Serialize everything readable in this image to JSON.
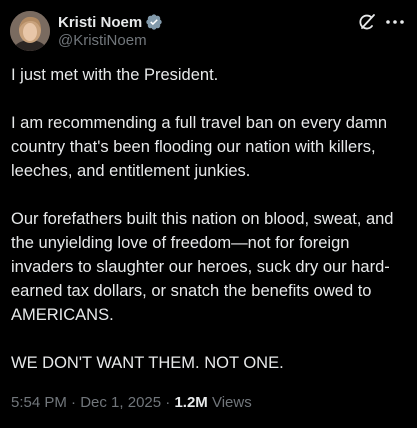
{
  "author": {
    "display_name": "Kristi Noem",
    "handle": "@KristiNoem",
    "verified": true
  },
  "icons": {
    "verified": "verified-badge-icon",
    "grok": "grok-icon",
    "more": "more-icon"
  },
  "colors": {
    "background": "#000000",
    "text_primary": "#e7e9ea",
    "text_secondary": "#71767b",
    "verified_badge": "#829aab"
  },
  "tweet": {
    "paragraphs": [
      "I just met with the President.",
      "I am recommending a full travel ban on every damn country that's been flooding our nation with killers, leeches, and entitlement junkies.",
      "Our forefathers built this nation on blood, sweat, and the unyielding love of freedom—not for foreign invaders to slaughter our heroes, suck dry our hard-earned tax dollars, or snatch the benefits owed to AMERICANS.",
      "WE DON'T WANT THEM. NOT ONE."
    ]
  },
  "meta": {
    "time": "5:54 PM",
    "separator": " · ",
    "date": "Dec 1, 2025",
    "views_count": "1.2M",
    "views_label": " Views"
  }
}
